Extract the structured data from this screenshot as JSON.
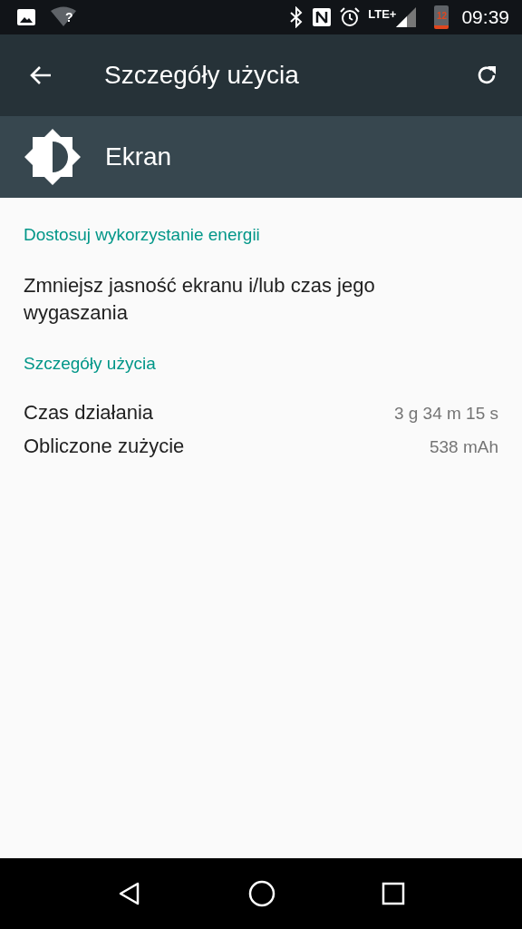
{
  "status_bar": {
    "wifi_badge": "?",
    "network": "LTE+",
    "battery": "12",
    "time": "09:39"
  },
  "app_bar": {
    "title": "Szczegóły użycia"
  },
  "header": {
    "title": "Ekran"
  },
  "sections": [
    {
      "title": "Dostosuj wykorzystanie energii",
      "items": [
        {
          "kind": "text",
          "label": "Zmniejsz jasność ekranu i/lub czas jego wygaszania"
        }
      ]
    },
    {
      "title": "Szczegóły użycia",
      "items": [
        {
          "kind": "value",
          "label": "Czas działania",
          "value": "3 g 34 m 15 s"
        },
        {
          "kind": "value",
          "label": "Obliczone zużycie",
          "value": "538 mAh"
        }
      ]
    }
  ]
}
